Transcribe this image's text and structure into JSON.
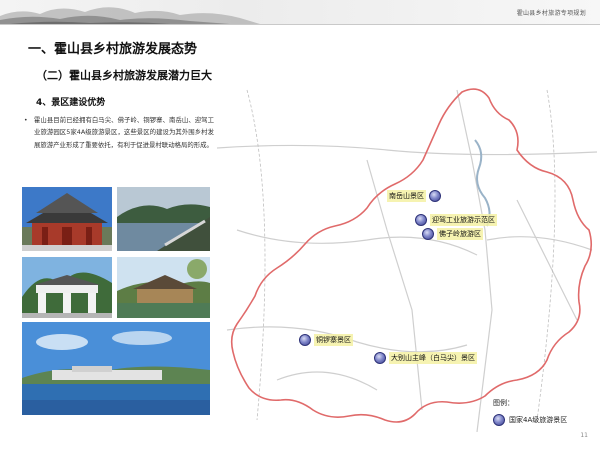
{
  "header": {
    "doc_title": "霍山县乡村旅游专项规划"
  },
  "headings": {
    "h1": "一、霍山县乡村旅游发展态势",
    "h2": "（二）霍山县乡村旅游发展潜力巨大",
    "h3": "4、景区建设优势"
  },
  "body": {
    "bullet": "•",
    "paragraph": "霍山县目前已经拥有白马尖、佛子岭、铜锣寨、南岳山、迎驾工业旅游园区5家4A级旅游景区，这些景区的建设为其外围乡村发展旅游产业形成了重要依托，有利于促进景村联动格局的形成。"
  },
  "map": {
    "pois": [
      {
        "label": "南岳山景区"
      },
      {
        "label": "迎驾工业旅游示范区"
      },
      {
        "label": "佛子岭旅游区"
      },
      {
        "label": "铜锣寨景区"
      },
      {
        "label": "大别山主峰（白马尖）景区"
      }
    ],
    "legend": {
      "title": "图例：",
      "item": "国家4A级旅游景区"
    }
  },
  "page_number": "11",
  "colors": {
    "poi_label_bg": "#f5f1a3",
    "boundary": "#e06a6a",
    "poi_marker": "#4a4f9e"
  }
}
